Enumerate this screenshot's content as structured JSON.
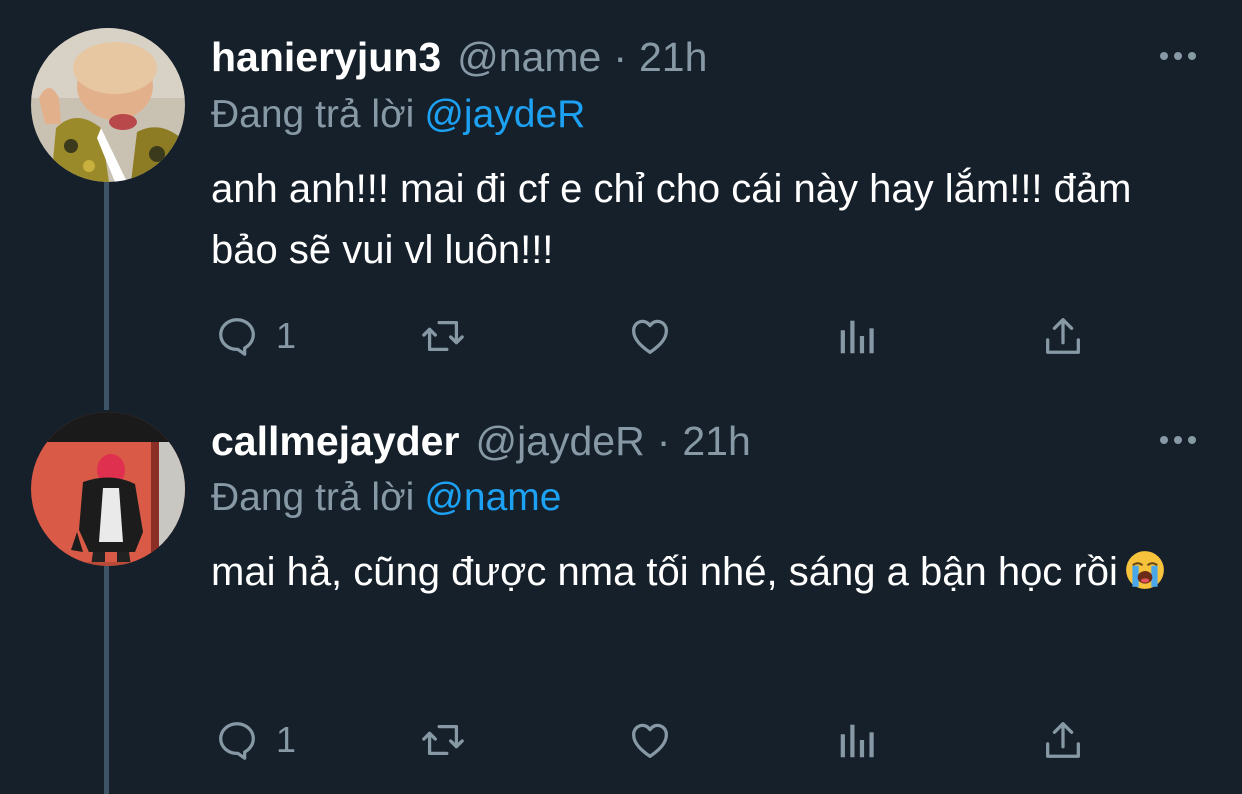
{
  "colors": {
    "background": "#15202b",
    "text": "#ffffff",
    "secondary": "#8899a6",
    "accent": "#1da1f2",
    "thread_line": "#3d5466"
  },
  "tweets": [
    {
      "display_name": "hanieryjun3",
      "handle": "@name",
      "separator": "·",
      "time": "21h",
      "replying_prefix": "Đang trả lời",
      "replying_to": "@jaydeR",
      "text": "anh anh!!! mai đi cf e chỉ cho cái này hay lắm!!! đảm bảo sẽ vui vl luôn!!!",
      "reply_count": "1",
      "icons": [
        "reply-icon",
        "retweet-icon",
        "like-icon",
        "analytics-icon",
        "share-icon",
        "more-icon"
      ]
    },
    {
      "display_name": "callmejayder",
      "handle": "@jaydeR",
      "separator": "·",
      "time": "21h",
      "replying_prefix": "Đang trả lời",
      "replying_to": "@name",
      "text": "mai hả, cũng được nma tối nhé, sáng a bận học rồi",
      "emoji": "loudly-crying-face",
      "reply_count": "1",
      "icons": [
        "reply-icon",
        "retweet-icon",
        "like-icon",
        "analytics-icon",
        "share-icon",
        "more-icon"
      ]
    }
  ]
}
